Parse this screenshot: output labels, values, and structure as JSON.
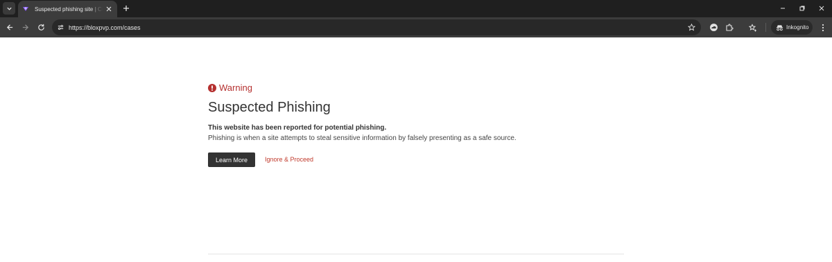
{
  "browser": {
    "tab": {
      "title": "Suspected phishing site | Cloudflare",
      "favicon": "cloudflare-icon"
    },
    "address_bar": {
      "url": "https://bloxpvp.com/cases"
    },
    "profile_chip": {
      "label": "Inkognito",
      "icon": "incognito-icon"
    },
    "toolbar_icons": [
      "back-icon",
      "forward-icon",
      "reload-icon",
      "site-info-icon",
      "bookmark-star-icon",
      "extension-cloud-icon",
      "extensions-puzzle-icon",
      "bookmarks-icon",
      "menu-kebab-icon"
    ],
    "window_controls": [
      "minimize-icon",
      "restore-icon",
      "close-icon"
    ]
  },
  "page": {
    "warning_label": "Warning",
    "title": "Suspected Phishing",
    "description_bold": "This website has been reported for potential phishing.",
    "description": "Phishing is when a site attempts to steal sensitive information by falsely presenting as a safe source.",
    "learn_more_label": "Learn More",
    "ignore_label": "Ignore & Proceed"
  },
  "colors": {
    "warning_red": "#b5302f",
    "link_red": "#c0392b",
    "button_bg": "#333333",
    "chrome_dark": "#1f1f1f",
    "toolbar": "#3c3c3c"
  }
}
